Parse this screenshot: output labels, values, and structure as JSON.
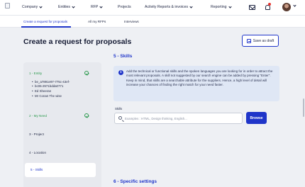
{
  "nav": {
    "items": [
      {
        "label": "Company"
      },
      {
        "label": "Entities"
      },
      {
        "label": "RFP"
      },
      {
        "label": "Projects"
      },
      {
        "label": "Activity Reports & invoices"
      },
      {
        "label": "Reporting"
      }
    ]
  },
  "subtabs": [
    {
      "label": "Create a request for proposals",
      "active": true
    },
    {
      "label": "All my RFPs"
    },
    {
      "label": "Interviews"
    }
  ],
  "page": {
    "title": "Create a request for proposals",
    "save_draft_label": "Save as draft"
  },
  "stepper": {
    "steps": [
      {
        "label": "1 - Entity",
        "status": "done"
      },
      {
        "label": "2 - My Need",
        "status": "done"
      },
      {
        "label": "3 - Project",
        "status": "pending"
      },
      {
        "label": "4 - Location",
        "status": "pending"
      },
      {
        "label": "5 - Skills",
        "status": "active"
      }
    ],
    "entity_details": [
      "be_a7891e97-775c-43ef-",
      "bc06-2971bdda0771",
      "Ed Sheeran",
      "Mr Conan The wise"
    ]
  },
  "skills": {
    "section_title": "5 - Skills",
    "info_text": "Add the technical or functional skills and the spoken languages you are looking for in order to attract the most relevant proposals. A skill not suggested by our search engine can be added by pressing \"Enter\". Keep in mind, that skills are a searchable attribute for the suppliers. Hence, a high level of detail will increase your chances of finding the right match for your need faster.",
    "field_label": "Skills",
    "placeholder": "Examples : HTML, Design thinking, English...",
    "browse_label": "Browse"
  },
  "next_section_title": "6 - Specific settings",
  "colors": {
    "accent": "#1f35c9",
    "success": "#2c9a4e",
    "info_bg": "#dfe7f5",
    "notification": "#e5322d"
  }
}
